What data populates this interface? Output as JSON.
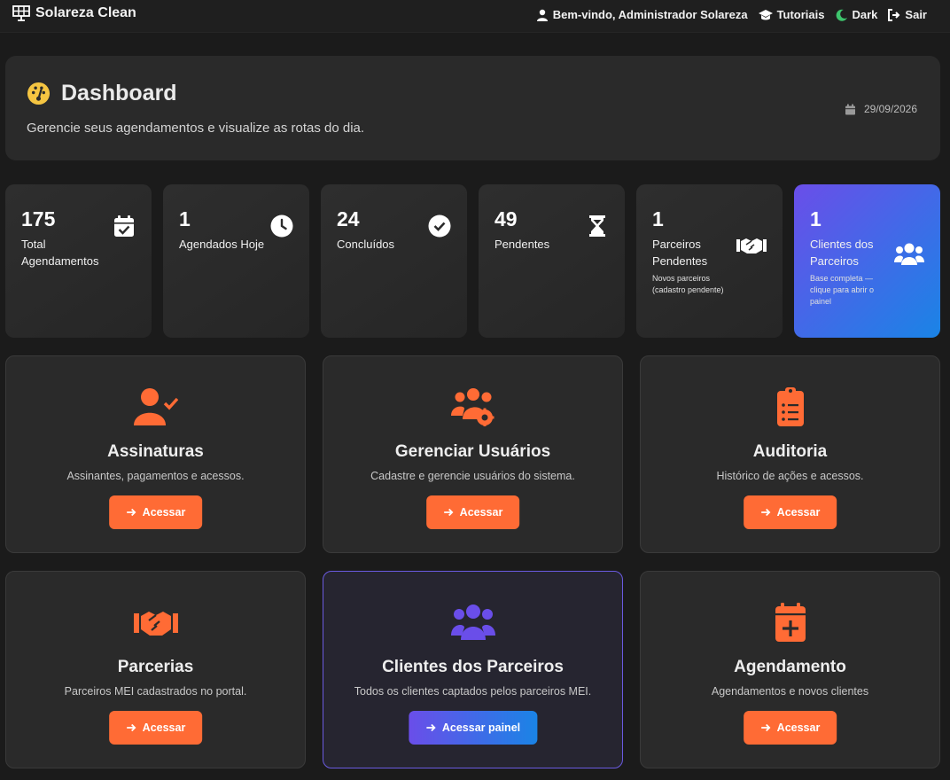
{
  "nav": {
    "brand": "Solareza Clean",
    "welcome": "Bem-vindo, Administrador Solareza",
    "tutorials": "Tutoriais",
    "theme": "Dark",
    "logout": "Sair"
  },
  "header": {
    "title": "Dashboard",
    "subtitle": "Gerencie seus agendamentos e visualize as rotas do dia.",
    "date": "29/09/2026"
  },
  "stats": [
    {
      "value": "175",
      "label": "Total Agendamentos",
      "icon": "calendar-check-icon"
    },
    {
      "value": "1",
      "label": "Agendados Hoje",
      "icon": "clock-icon"
    },
    {
      "value": "24",
      "label": "Concluídos",
      "icon": "check-circle-icon"
    },
    {
      "value": "49",
      "label": "Pendentes",
      "icon": "hourglass-icon"
    },
    {
      "value": "1",
      "label": "Parceiros Pendentes",
      "note": "Novos parceiros (cadastro pendente)",
      "icon": "handshake-icon"
    },
    {
      "value": "1",
      "label": "Clientes dos Parceiros",
      "note": "Base completa — clique para abrir o painel",
      "icon": "users-icon"
    }
  ],
  "cards": [
    {
      "title": "Assinaturas",
      "desc": "Assinantes, pagamentos e acessos.",
      "button": "Acessar",
      "icon": "user-check-icon"
    },
    {
      "title": "Gerenciar Usuários",
      "desc": "Cadastre e gerencie usuários do sistema.",
      "button": "Acessar",
      "icon": "users-cog-icon"
    },
    {
      "title": "Auditoria",
      "desc": "Histórico de ações e acessos.",
      "button": "Acessar",
      "icon": "clipboard-list-icon"
    },
    {
      "title": "Parcerias",
      "desc": "Parceiros MEI cadastrados no portal.",
      "button": "Acessar",
      "icon": "handshake-icon"
    },
    {
      "title": "Clientes dos Parceiros",
      "desc": "Todos os clientes captados pelos parceiros MEI.",
      "button": "Acessar painel",
      "icon": "users-icon"
    },
    {
      "title": "Agendamento",
      "desc": "Agendamentos e novos clientes",
      "button": "Acessar",
      "icon": "calendar-plus-icon"
    }
  ],
  "colors": {
    "accent": "#ff6b35",
    "purple": "#6a4ee9",
    "blue": "#1a84e6",
    "background": "#1b1b1b",
    "card": "#2a2a2a"
  }
}
